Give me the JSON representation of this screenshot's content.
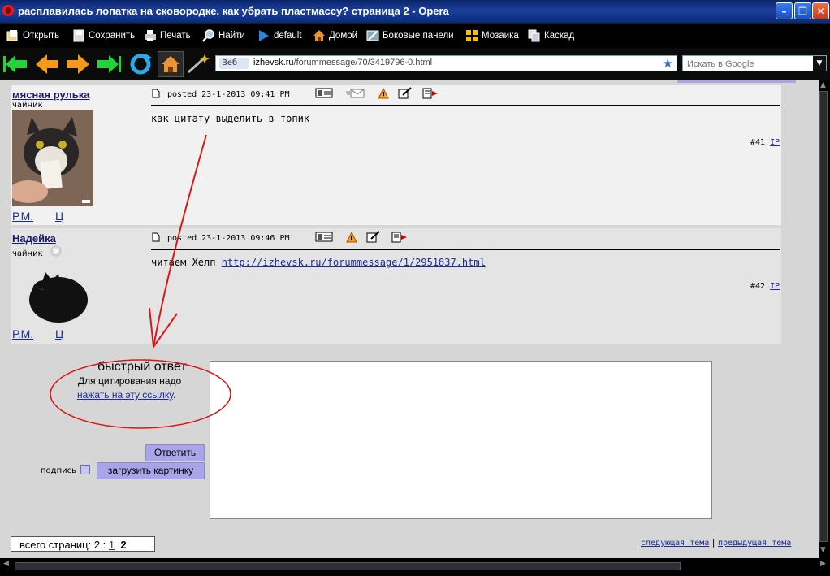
{
  "window": {
    "title": "расплавилась лопатка на сковородке. как убрать пластмассу? страница 2 - Opera"
  },
  "menubar": {
    "items": [
      {
        "label": "Открыть",
        "icon": "open-icon"
      },
      {
        "label": "Сохранить",
        "icon": "save-icon"
      },
      {
        "label": "Печать",
        "icon": "print-icon"
      },
      {
        "label": "Найти",
        "icon": "find-icon"
      },
      {
        "label": "default",
        "icon": "default-icon"
      },
      {
        "label": "Домой",
        "icon": "home-icon"
      },
      {
        "label": "Боковые панели",
        "icon": "panels-icon"
      },
      {
        "label": "Мозаика",
        "icon": "tile-icon"
      },
      {
        "label": "Каскад",
        "icon": "cascade-icon"
      }
    ]
  },
  "addressbar": {
    "badge": "Веб",
    "domain": "izhevsk.ru",
    "path": "/forummessage/70/3419796-0.html"
  },
  "search": {
    "placeholder": "Искать в Google"
  },
  "posts": [
    {
      "username": "мясная рулька",
      "rank": "чайник",
      "posted": "posted 23-1-2013 09:41 PM",
      "text": "как цитату выделить в топик",
      "link": "",
      "number": "#41",
      "ip": "IP",
      "link_pm": "Р.М.",
      "link_q": "Ц"
    },
    {
      "username": "Надейка",
      "rank": "чайник",
      "posted": "posted 23-1-2013 09:46 PM",
      "text": "читаем Хелп ",
      "link": "http://izhevsk.ru/forummessage/1/2951837.html",
      "number": "#42",
      "ip": "IP",
      "link_pm": "Р.М.",
      "link_q": "Ц"
    }
  ],
  "quick_reply": {
    "title": "быстрый ответ",
    "hint": "Для цитирования надо",
    "hint_link": "нажать на эту ссылку",
    "hint_end": ".",
    "reply_button": "Ответить",
    "signature_label": "подпись",
    "upload_button": "загрузить картинку"
  },
  "pager": {
    "label": "всего страниц: 2 : ",
    "page1": "1",
    "page2": "2"
  },
  "thread_nav": {
    "next": "следующая тема",
    "separator": "|",
    "prev": "предыдущая тема"
  },
  "colors": {
    "annotation": "#d81818",
    "button_bg": "#a8a6e8",
    "link": "#1a2d99"
  }
}
